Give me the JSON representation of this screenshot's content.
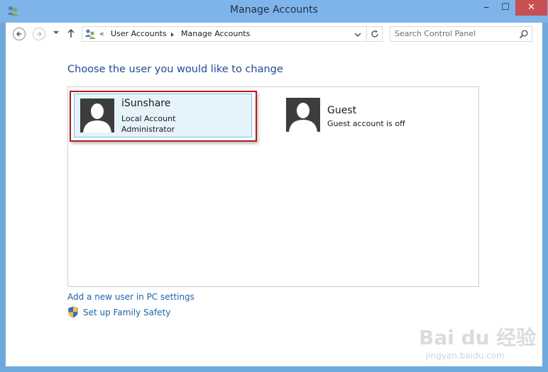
{
  "window": {
    "title": "Manage Accounts",
    "minimize_glyph": "‒",
    "maximize_glyph": "☐",
    "close_glyph": "✕"
  },
  "navbar": {
    "breadcrumb_prefix": "«",
    "breadcrumbs": [
      "User Accounts",
      "Manage Accounts"
    ],
    "search_placeholder": "Search Control Panel"
  },
  "main": {
    "heading": "Choose the user you would like to change",
    "accounts": [
      {
        "name": "iSunshare",
        "line1": "Local Account",
        "line2": "Administrator",
        "selected": true
      },
      {
        "name": "Guest",
        "line1": "Guest account is off",
        "selected": false
      }
    ],
    "links": {
      "add_user": "Add a new user in PC settings",
      "family_safety": "Set up Family Safety"
    }
  },
  "watermark": {
    "logo": "Bai du 经验",
    "url": "jingyan.baidu.com"
  },
  "colors": {
    "titlebar": "#7eb4ea",
    "close_button": "#c75050",
    "heading": "#1e4a8f",
    "link": "#1c62a8",
    "selection_fill": "#e5f3fb",
    "highlight_frame": "#b01c1c"
  }
}
